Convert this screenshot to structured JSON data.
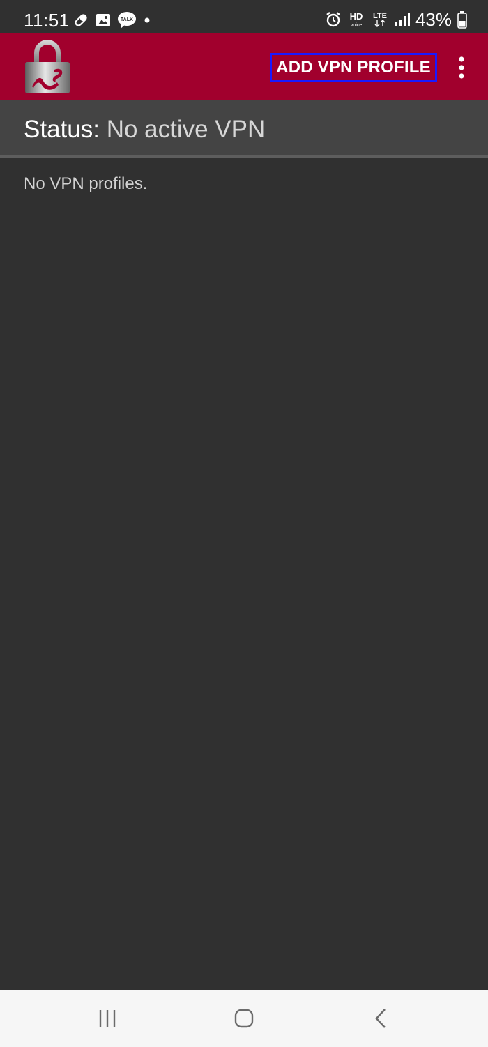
{
  "status_bar": {
    "time": "11:51",
    "battery_percent": "43%",
    "left_icons": [
      "pill-icon",
      "gallery-icon",
      "talk-icon",
      "dot-icon"
    ],
    "right_icons": [
      "alarm-icon",
      "hd-voice-icon",
      "lte-icon",
      "signal-icon",
      "battery-icon"
    ]
  },
  "app_bar": {
    "background": "#a1002d",
    "logo": "strongswan-lock-logo",
    "add_profile_label": "ADD VPN PROFILE",
    "menu_icon": "overflow-menu-icon"
  },
  "status": {
    "label": "Status:",
    "value": "No active VPN"
  },
  "profiles": {
    "empty_message": "No VPN profiles."
  },
  "nav_bar": {
    "buttons": [
      "recents-icon",
      "home-icon",
      "back-icon"
    ]
  }
}
